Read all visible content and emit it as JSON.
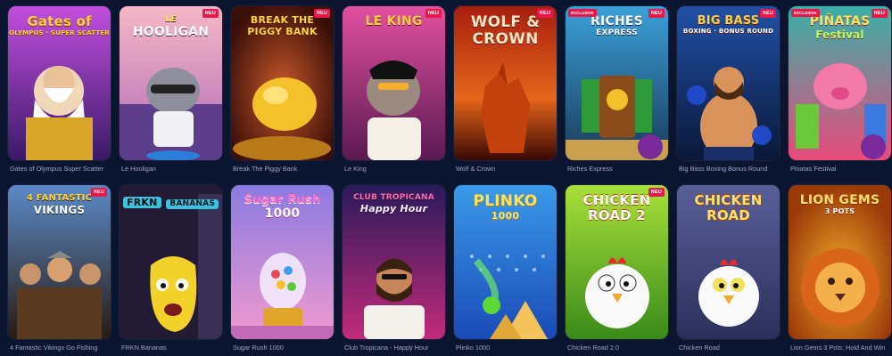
{
  "badges": {
    "new": "NEU",
    "exclusive": "EXCLUSIVE"
  },
  "games": [
    {
      "caption": "Gates of Olympus Super Scatter",
      "logo1": "Gates of",
      "logo2": "OLYMPUS · SUPER SCATTER",
      "color": "#b14cd8"
    },
    {
      "caption": "Le Hooligan",
      "logo1": "LE",
      "logo2": "HOOLIGAN",
      "color": "#f29aa8",
      "badge": "NEU"
    },
    {
      "caption": "Break The Piggy Bank",
      "logo1": "BREAK THE",
      "logo2": "PIGGY BANK",
      "color": "#7a2a18",
      "badge": "NEU"
    },
    {
      "caption": "Le King",
      "logo1": "LE KING",
      "logo2": "",
      "color": "#c43d7a",
      "badge": "NEU"
    },
    {
      "caption": "Wolf & Crown",
      "logo1": "WOLF &",
      "logo2": "CROWN",
      "color": "#8f1a0c",
      "badge": "NEU"
    },
    {
      "caption": "Riches Express",
      "logo1": "RICHES",
      "logo2": "EXPRESS",
      "color": "#1e6b8f",
      "badge": "NEU",
      "badge_left": "EXCLUSIVE"
    },
    {
      "caption": "Big Bass Boxing Bonus Round",
      "logo1": "BIG BASS",
      "logo2": "BOXING · BONUS ROUND",
      "color": "#1b3e7a",
      "badge": "NEU"
    },
    {
      "caption": "Pinatas Festival",
      "logo1": "PIÑATAS",
      "logo2": "Festival",
      "color": "#d93a5c",
      "badge": "NEU",
      "badge_left": "EXCLUSIVE"
    },
    {
      "caption": "4 Fantastic Vikings Go Fishing",
      "logo1": "4 FANTASTIC",
      "logo2": "VIKINGS",
      "color": "#3a5c86",
      "badge": "NEU"
    },
    {
      "caption": "FRKN Bananas",
      "logo1": "FRKN",
      "logo2": "BANANAS",
      "color": "#2b1e3e"
    },
    {
      "caption": "Sugar Rush 1000",
      "logo1": "Sugar Rush",
      "logo2": "1000",
      "color": "#e78ad6"
    },
    {
      "caption": "Club Tropicana - Happy Hour",
      "logo1": "CLUB TROPICANA",
      "logo2": "Happy Hour",
      "color": "#7a1d8e"
    },
    {
      "caption": "Plinko 1000",
      "logo1": "PLINKO",
      "logo2": "1000",
      "color": "#2d7ed8"
    },
    {
      "caption": "Chicken Road 2.0",
      "logo1": "CHICKEN",
      "logo2": "ROAD 2",
      "color": "#8fd02a",
      "badge": "NEU"
    },
    {
      "caption": "Chicken Road",
      "logo1": "CHICKEN",
      "logo2": "ROAD",
      "color": "#4a4f82"
    },
    {
      "caption": "Lion Gems 3 Pots: Hold And Win",
      "logo1": "LION GEMS",
      "logo2": "3 POTS",
      "color": "#e86a12"
    }
  ]
}
